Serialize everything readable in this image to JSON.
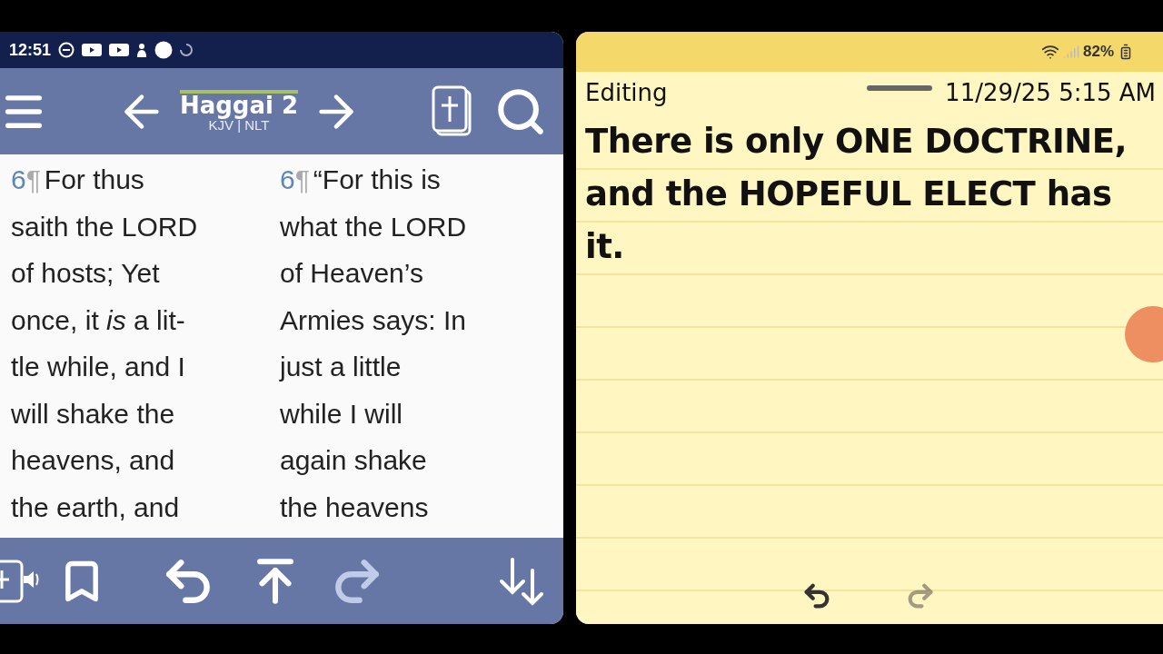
{
  "bible_app": {
    "status_bar": {
      "time": "12:51"
    },
    "toolbar": {
      "book_title": "Haggai 2",
      "versions": "KJV | NLT"
    },
    "columns": [
      {
        "verse_number": "6",
        "pilcrow": "¶",
        "lines": [
          "For thus",
          "saith the LORD",
          "of hosts; Yet",
          "once, it *is* a lit-",
          "tle while, and I",
          "will shake the",
          "heavens, and",
          "the earth, and"
        ]
      },
      {
        "verse_number": "6",
        "pilcrow": "¶",
        "lines": [
          "“For this is",
          "what the LORD",
          "of Heaven’s",
          "Armies says: In",
          "just a little",
          "while I will",
          "again shake",
          "the heavens"
        ]
      }
    ],
    "bottom_toolbar": {
      "redo_disabled": true
    }
  },
  "notes_app": {
    "status_bar": {
      "battery": "82%"
    },
    "header": {
      "mode": "Editing",
      "timestamp": "11/29/25 5:15 AM"
    },
    "note_text": "There is only ONE DOCTRINE, and the HOPEFUL ELECT has it.",
    "redo_disabled": true
  }
}
